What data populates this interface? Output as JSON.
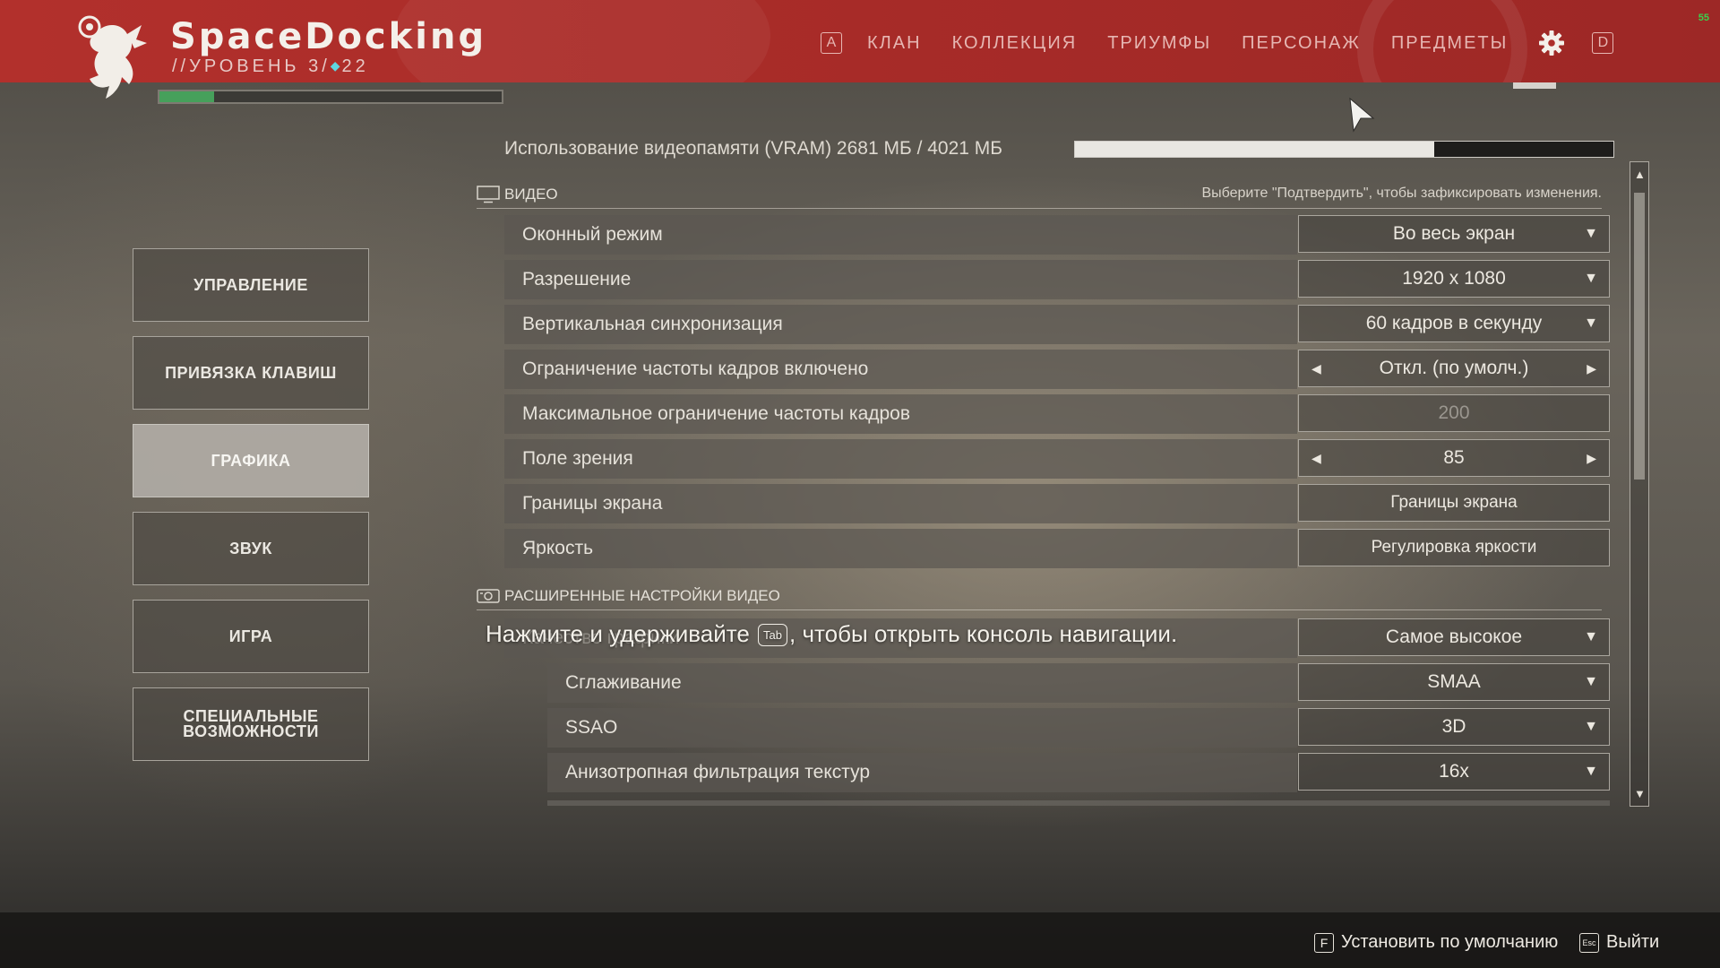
{
  "header": {
    "player_name": "SpaceDocking",
    "level_prefix": "//УРОВЕНЬ 3/",
    "level_rank": "22",
    "xp_progress": 0.16,
    "fps": "55",
    "nav": {
      "key_left": "A",
      "items": [
        "КЛАН",
        "КОЛЛЕКЦИЯ",
        "ТРИУМФЫ",
        "ПЕРСОНАЖ",
        "ПРЕДМЕТЫ"
      ],
      "key_right": "D"
    }
  },
  "sidebar": {
    "items": [
      {
        "label": "УПРАВЛЕНИЕ",
        "active": false
      },
      {
        "label": "ПРИВЯЗКА КЛАВИШ",
        "active": false
      },
      {
        "label": "ГРАФИКА",
        "active": true
      },
      {
        "label": "ЗВУК",
        "active": false
      },
      {
        "label": "ИГРА",
        "active": false
      },
      {
        "label": "СПЕЦИАЛЬНЫЕ ВОЗМОЖНОСТИ",
        "active": false
      }
    ]
  },
  "vram": {
    "label": "Использование видеопамяти (VRAM) 2681 МБ / 4021 МБ",
    "used_mb": 2681,
    "total_mb": 4021
  },
  "video": {
    "title": "ВИДЕО",
    "hint": "Выберите \"Подтвердить\", чтобы зафиксировать изменения.",
    "rows": [
      {
        "label": "Оконный режим",
        "value": "Во весь экран"
      },
      {
        "label": "Разрешение",
        "value": "1920 x 1080"
      },
      {
        "label": "Вертикальная синхронизация",
        "value": "60 кадров в секунду"
      },
      {
        "label": "Ограничение частоты кадров включено",
        "value": "Откл. (по умолч.)"
      },
      {
        "label": "Максимальное ограничение частоты кадров",
        "value": "200"
      },
      {
        "label": "Поле зрения",
        "value": "85"
      },
      {
        "label": "Границы экрана",
        "value": "Границы экрана"
      },
      {
        "label": "Яркость",
        "value": "Регулировка яркости"
      }
    ]
  },
  "advanced": {
    "title": "РАСШИРЕННЫЕ НАСТРОЙКИ ВИДЕО",
    "rows": [
      {
        "label": "Качество графики",
        "value": "Самое высокое"
      },
      {
        "label": "Сглаживание",
        "value": "SMAA"
      },
      {
        "label": "SSAO",
        "value": "3D"
      },
      {
        "label": "Анизотропная фильтрация текстур",
        "value": "16x"
      }
    ]
  },
  "toast": {
    "before": "Нажмите и удерживайте",
    "key": "Tab",
    "after": ", чтобы открыть консоль навигации."
  },
  "footer": {
    "reset_key": "F",
    "reset_label": "Установить по умолчанию",
    "exit_key": "Esc",
    "exit_label": "Выйти"
  },
  "colors": {
    "header_red": "#b2302c",
    "xp_green": "#46a05b",
    "rank_cyan": "#5fd6e0",
    "fps_green": "#39d24c"
  }
}
